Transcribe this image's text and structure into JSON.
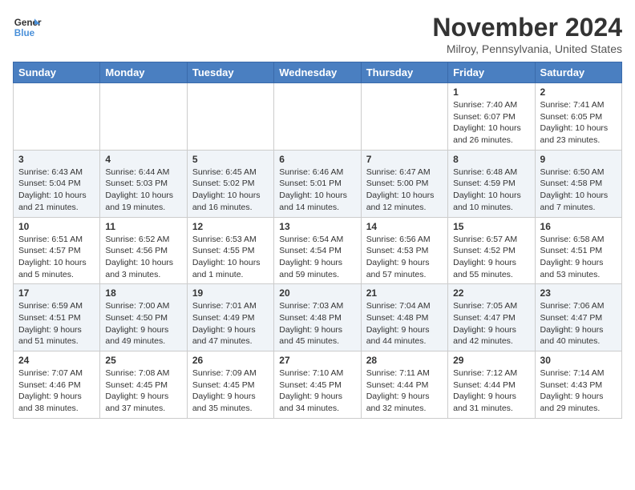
{
  "logo": {
    "line1": "General",
    "line2": "Blue"
  },
  "title": "November 2024",
  "location": "Milroy, Pennsylvania, United States",
  "days_of_week": [
    "Sunday",
    "Monday",
    "Tuesday",
    "Wednesday",
    "Thursday",
    "Friday",
    "Saturday"
  ],
  "weeks": [
    [
      {
        "day": "",
        "info": ""
      },
      {
        "day": "",
        "info": ""
      },
      {
        "day": "",
        "info": ""
      },
      {
        "day": "",
        "info": ""
      },
      {
        "day": "",
        "info": ""
      },
      {
        "day": "1",
        "info": "Sunrise: 7:40 AM\nSunset: 6:07 PM\nDaylight: 10 hours and 26 minutes."
      },
      {
        "day": "2",
        "info": "Sunrise: 7:41 AM\nSunset: 6:05 PM\nDaylight: 10 hours and 23 minutes."
      }
    ],
    [
      {
        "day": "3",
        "info": "Sunrise: 6:43 AM\nSunset: 5:04 PM\nDaylight: 10 hours and 21 minutes."
      },
      {
        "day": "4",
        "info": "Sunrise: 6:44 AM\nSunset: 5:03 PM\nDaylight: 10 hours and 19 minutes."
      },
      {
        "day": "5",
        "info": "Sunrise: 6:45 AM\nSunset: 5:02 PM\nDaylight: 10 hours and 16 minutes."
      },
      {
        "day": "6",
        "info": "Sunrise: 6:46 AM\nSunset: 5:01 PM\nDaylight: 10 hours and 14 minutes."
      },
      {
        "day": "7",
        "info": "Sunrise: 6:47 AM\nSunset: 5:00 PM\nDaylight: 10 hours and 12 minutes."
      },
      {
        "day": "8",
        "info": "Sunrise: 6:48 AM\nSunset: 4:59 PM\nDaylight: 10 hours and 10 minutes."
      },
      {
        "day": "9",
        "info": "Sunrise: 6:50 AM\nSunset: 4:58 PM\nDaylight: 10 hours and 7 minutes."
      }
    ],
    [
      {
        "day": "10",
        "info": "Sunrise: 6:51 AM\nSunset: 4:57 PM\nDaylight: 10 hours and 5 minutes."
      },
      {
        "day": "11",
        "info": "Sunrise: 6:52 AM\nSunset: 4:56 PM\nDaylight: 10 hours and 3 minutes."
      },
      {
        "day": "12",
        "info": "Sunrise: 6:53 AM\nSunset: 4:55 PM\nDaylight: 10 hours and 1 minute."
      },
      {
        "day": "13",
        "info": "Sunrise: 6:54 AM\nSunset: 4:54 PM\nDaylight: 9 hours and 59 minutes."
      },
      {
        "day": "14",
        "info": "Sunrise: 6:56 AM\nSunset: 4:53 PM\nDaylight: 9 hours and 57 minutes."
      },
      {
        "day": "15",
        "info": "Sunrise: 6:57 AM\nSunset: 4:52 PM\nDaylight: 9 hours and 55 minutes."
      },
      {
        "day": "16",
        "info": "Sunrise: 6:58 AM\nSunset: 4:51 PM\nDaylight: 9 hours and 53 minutes."
      }
    ],
    [
      {
        "day": "17",
        "info": "Sunrise: 6:59 AM\nSunset: 4:51 PM\nDaylight: 9 hours and 51 minutes."
      },
      {
        "day": "18",
        "info": "Sunrise: 7:00 AM\nSunset: 4:50 PM\nDaylight: 9 hours and 49 minutes."
      },
      {
        "day": "19",
        "info": "Sunrise: 7:01 AM\nSunset: 4:49 PM\nDaylight: 9 hours and 47 minutes."
      },
      {
        "day": "20",
        "info": "Sunrise: 7:03 AM\nSunset: 4:48 PM\nDaylight: 9 hours and 45 minutes."
      },
      {
        "day": "21",
        "info": "Sunrise: 7:04 AM\nSunset: 4:48 PM\nDaylight: 9 hours and 44 minutes."
      },
      {
        "day": "22",
        "info": "Sunrise: 7:05 AM\nSunset: 4:47 PM\nDaylight: 9 hours and 42 minutes."
      },
      {
        "day": "23",
        "info": "Sunrise: 7:06 AM\nSunset: 4:47 PM\nDaylight: 9 hours and 40 minutes."
      }
    ],
    [
      {
        "day": "24",
        "info": "Sunrise: 7:07 AM\nSunset: 4:46 PM\nDaylight: 9 hours and 38 minutes."
      },
      {
        "day": "25",
        "info": "Sunrise: 7:08 AM\nSunset: 4:45 PM\nDaylight: 9 hours and 37 minutes."
      },
      {
        "day": "26",
        "info": "Sunrise: 7:09 AM\nSunset: 4:45 PM\nDaylight: 9 hours and 35 minutes."
      },
      {
        "day": "27",
        "info": "Sunrise: 7:10 AM\nSunset: 4:45 PM\nDaylight: 9 hours and 34 minutes."
      },
      {
        "day": "28",
        "info": "Sunrise: 7:11 AM\nSunset: 4:44 PM\nDaylight: 9 hours and 32 minutes."
      },
      {
        "day": "29",
        "info": "Sunrise: 7:12 AM\nSunset: 4:44 PM\nDaylight: 9 hours and 31 minutes."
      },
      {
        "day": "30",
        "info": "Sunrise: 7:14 AM\nSunset: 4:43 PM\nDaylight: 9 hours and 29 minutes."
      }
    ]
  ]
}
